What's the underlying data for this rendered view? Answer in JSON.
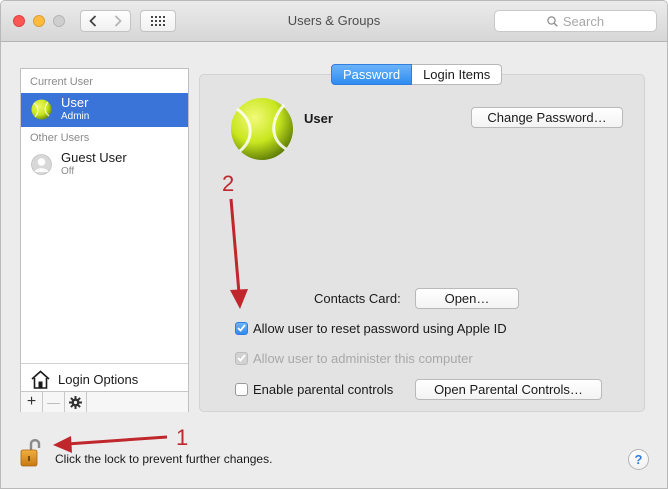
{
  "window": {
    "title": "Users & Groups"
  },
  "search": {
    "placeholder": "Search"
  },
  "sidebar": {
    "current_user_header": "Current User",
    "current_user": {
      "name": "User",
      "role": "Admin"
    },
    "other_users_header": "Other Users",
    "other_users": [
      {
        "name": "Guest User",
        "status": "Off"
      }
    ],
    "login_options": "Login Options",
    "add_label": "+",
    "remove_label": "—"
  },
  "tabs": [
    {
      "label": "Password",
      "active": true
    },
    {
      "label": "Login Items",
      "active": false
    }
  ],
  "main": {
    "username": "User",
    "change_password": "Change Password…",
    "contacts_card_label": "Contacts Card:",
    "open_button": "Open…",
    "options": [
      {
        "label": "Allow user to reset password using Apple ID",
        "checked": true,
        "enabled": true
      },
      {
        "label": "Allow user to administer this computer",
        "checked": true,
        "enabled": false
      },
      {
        "label": "Enable parental controls",
        "checked": false,
        "enabled": true
      }
    ],
    "open_parental_controls": "Open Parental Controls…"
  },
  "footer": {
    "lock_text": "Click the lock to prevent further changes.",
    "help_label": "?"
  },
  "annotations": [
    {
      "label": "1"
    },
    {
      "label": "2"
    }
  ],
  "colors": {
    "selection": "#3a74d8",
    "accent": "#2e8cf0",
    "annotation": "#c0272d",
    "tennis_ball": "#c8e61e"
  },
  "icons": [
    "back-arrow-icon",
    "forward-arrow-icon",
    "grid-icon",
    "search-icon",
    "tennis-ball-avatar",
    "guest-avatar-icon",
    "house-icon",
    "gear-icon",
    "lock-icon",
    "help-icon"
  ]
}
